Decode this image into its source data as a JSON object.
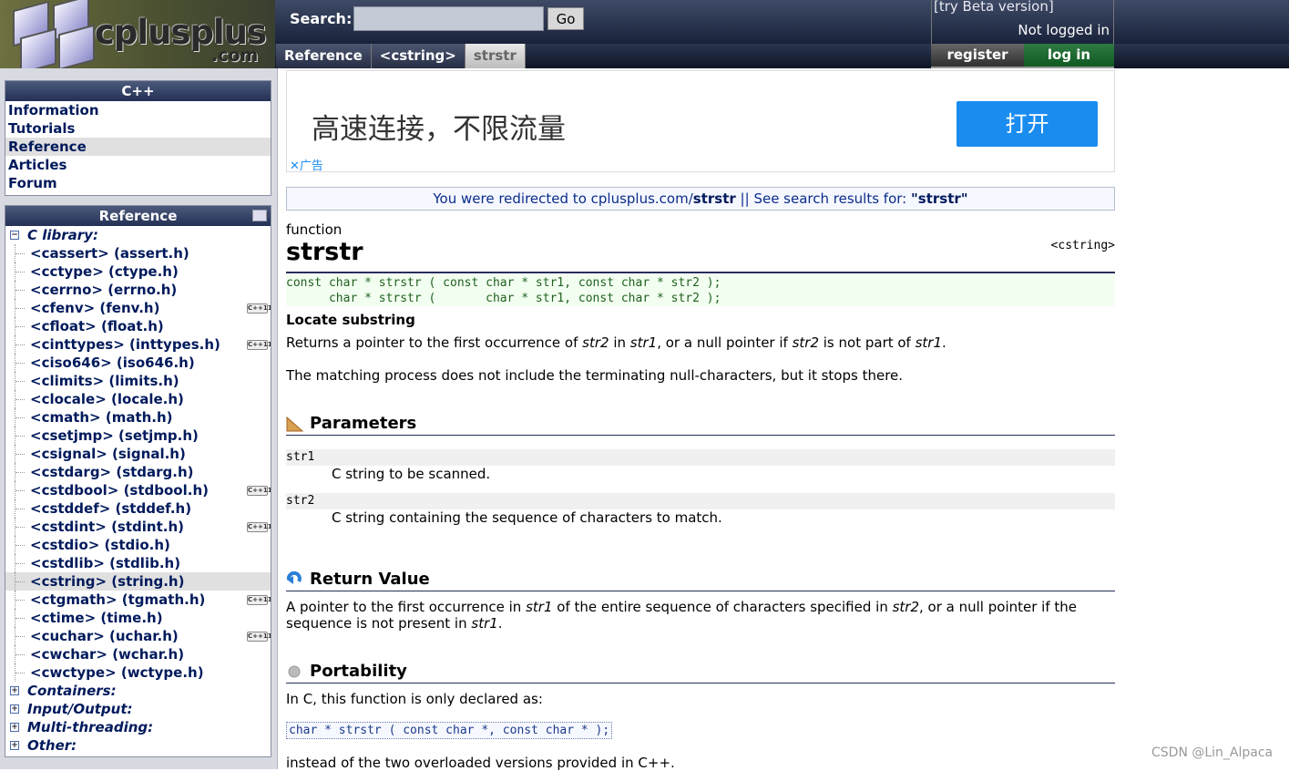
{
  "header": {
    "logo_main": "cplusplus",
    "logo_sub": ".com",
    "search_label": "Search:",
    "search_placeholder": "",
    "go_label": "Go",
    "beta_link": "[try Beta version]",
    "login_status": "Not logged in",
    "register_label": "register",
    "login_label": "log in",
    "breadcrumb": [
      "Reference",
      "<cstring>",
      "strstr"
    ]
  },
  "sidebar": {
    "cpp_panel": {
      "title": "C++",
      "items": [
        "Information",
        "Tutorials",
        "Reference",
        "Articles",
        "Forum"
      ],
      "selected": "Reference"
    },
    "reference_panel": {
      "title": "Reference",
      "group_c_library": "C library:",
      "c_headers": [
        {
          "label": "<cassert> (assert.h)",
          "cpp11": false
        },
        {
          "label": "<cctype> (ctype.h)",
          "cpp11": false
        },
        {
          "label": "<cerrno> (errno.h)",
          "cpp11": false
        },
        {
          "label": "<cfenv> (fenv.h)",
          "cpp11": true
        },
        {
          "label": "<cfloat> (float.h)",
          "cpp11": false
        },
        {
          "label": "<cinttypes> (inttypes.h)",
          "cpp11": true
        },
        {
          "label": "<ciso646> (iso646.h)",
          "cpp11": false
        },
        {
          "label": "<climits> (limits.h)",
          "cpp11": false
        },
        {
          "label": "<clocale> (locale.h)",
          "cpp11": false
        },
        {
          "label": "<cmath> (math.h)",
          "cpp11": false
        },
        {
          "label": "<csetjmp> (setjmp.h)",
          "cpp11": false
        },
        {
          "label": "<csignal> (signal.h)",
          "cpp11": false
        },
        {
          "label": "<cstdarg> (stdarg.h)",
          "cpp11": false
        },
        {
          "label": "<cstdbool> (stdbool.h)",
          "cpp11": true
        },
        {
          "label": "<cstddef> (stddef.h)",
          "cpp11": false
        },
        {
          "label": "<cstdint> (stdint.h)",
          "cpp11": true
        },
        {
          "label": "<cstdio> (stdio.h)",
          "cpp11": false
        },
        {
          "label": "<cstdlib> (stdlib.h)",
          "cpp11": false
        },
        {
          "label": "<cstring> (string.h)",
          "cpp11": false
        },
        {
          "label": "<ctgmath> (tgmath.h)",
          "cpp11": true
        },
        {
          "label": "<ctime> (time.h)",
          "cpp11": false
        },
        {
          "label": "<cuchar> (uchar.h)",
          "cpp11": true
        },
        {
          "label": "<cwchar> (wchar.h)",
          "cpp11": false
        },
        {
          "label": "<cwctype> (wctype.h)",
          "cpp11": false
        }
      ],
      "selected_header": "<cstring> (string.h)",
      "collapsed_groups": [
        "Containers:",
        "Input/Output:",
        "Multi-threading:",
        "Other:"
      ],
      "cpp11_badge": "C++11"
    }
  },
  "ad": {
    "text": "高速连接，不限流量",
    "button": "打开",
    "close_label": "广告"
  },
  "redirect": {
    "prefix": "You were redirected to ",
    "site": "cplusplus.com/",
    "target": "strstr",
    "sep": " || ",
    "search_prefix": "See search results for: ",
    "search_term": "\"strstr\""
  },
  "article": {
    "kind": "function",
    "title": "strstr",
    "header": "<cstring>",
    "prototype_1": "const char * strstr ( const char * str1, const char * str2 );",
    "prototype_2": "      char * strstr (       char * str1, const char * str2 );",
    "summary": "Locate substring",
    "desc_1": "Returns a pointer to the first occurrence of str2 in str1, or a null pointer if str2 is not part of str1.",
    "desc_2": "The matching process does not include the terminating null-characters, but it stops there.",
    "params_title": "Parameters",
    "params": [
      {
        "name": "str1",
        "desc": "C string to be scanned."
      },
      {
        "name": "str2",
        "desc": "C string containing the sequence of characters to match."
      }
    ],
    "return_title": "Return Value",
    "return_text_1": "A pointer to the first occurrence in str1 of the entire sequence of characters specified in str2, or a null pointer if the",
    "return_text_2": "sequence is not present in str1.",
    "portability_title": "Portability",
    "portability_text": "In C, this function is only declared as:",
    "c_prototype": "char * strstr ( const char *, const char * );",
    "portability_tail": "instead of the two overloaded versions provided in C++."
  },
  "watermark": "CSDN @Lin_Alpaca",
  "colors": {
    "nav_text": "#001a5c",
    "login_green": "#0f5a22",
    "ad_blue": "#1a8cf0",
    "proto_bg": "#f2fff0"
  }
}
